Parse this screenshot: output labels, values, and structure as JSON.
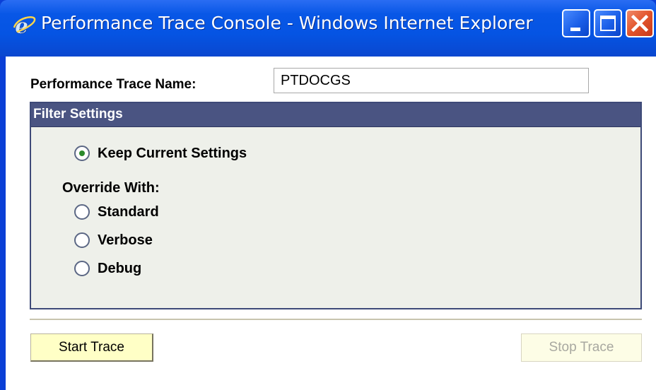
{
  "window": {
    "title": "Performance Trace Console - Windows Internet Explorer",
    "icon": "ie-icon",
    "controls": [
      "minimize-icon",
      "maximize-icon",
      "close-icon"
    ],
    "accent_color": "#0554e3"
  },
  "form": {
    "trace_name_label": "Performance Trace Name:",
    "trace_name_value": "PTDOCGS",
    "filter": {
      "title": "Filter Settings",
      "header_color": "#4a5482",
      "keep_current_label": "Keep Current Settings",
      "override_label": "Override With:",
      "options": [
        {
          "label": "Standard"
        },
        {
          "label": "Verbose"
        },
        {
          "label": "Debug"
        }
      ],
      "selected": "Keep Current Settings"
    },
    "start_button_label": "Start Trace",
    "stop_button_label": "Stop Trace",
    "stop_button_disabled": true
  }
}
